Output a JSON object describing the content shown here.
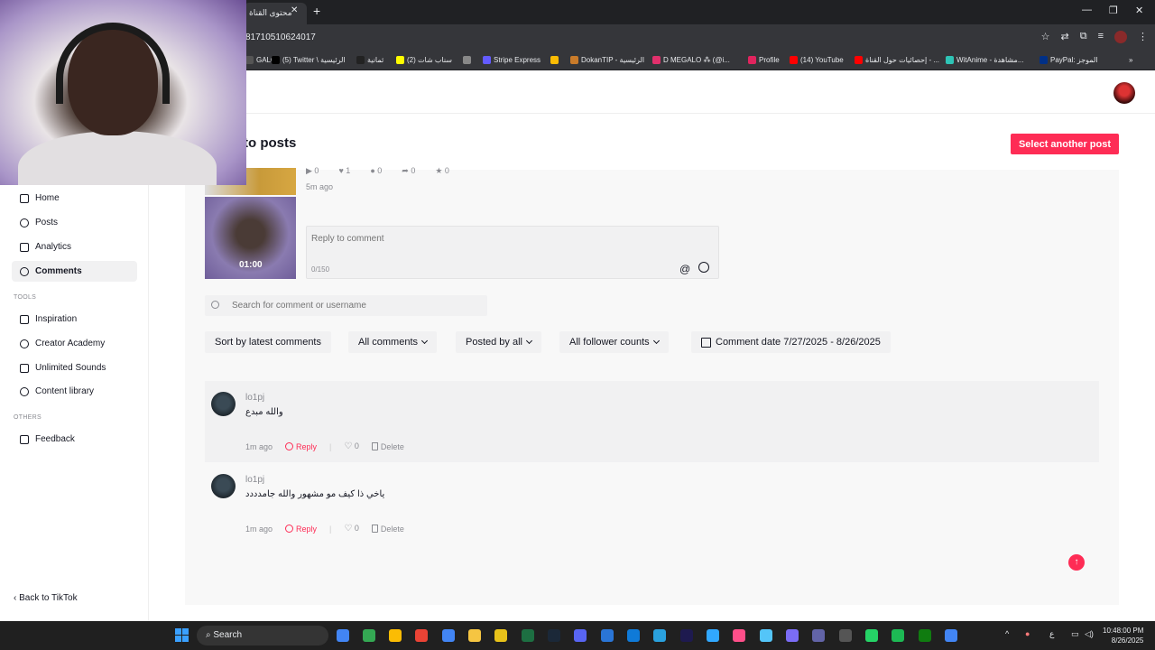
{
  "browser": {
    "tab_title": "محتوى القناة",
    "tab_close": "✕",
    "new_tab": "+",
    "url": "81710510624017",
    "window_controls": {
      "minimize": "—",
      "restore": "❐",
      "close": "✕"
    },
    "bookmarks_overflow": "»",
    "bookmarks": [
      {
        "label": "GALO",
        "color": "#555555"
      },
      {
        "label": "(5) Twitter \\ الرئيسية",
        "color": "#000000"
      },
      {
        "label": "ثمانية",
        "color": "#222222"
      },
      {
        "label": "(2) سناب شات",
        "color": "#fffc00"
      },
      {
        "label": "",
        "color": "#888888"
      },
      {
        "label": "Stripe Express",
        "color": "#635bff"
      },
      {
        "label": "",
        "color": "#fbbc04"
      },
      {
        "label": "DokanTIP - الرئيسية",
        "color": "#c97b2a"
      },
      {
        "label": "D MEGALO ⁂ (@i...",
        "color": "#e1306c"
      },
      {
        "label": "Profile",
        "color": "#e0245e"
      },
      {
        "label": "(14) YouTube",
        "color": "#ff0000"
      },
      {
        "label": "إحصائيات حول القناة - ...",
        "color": "#ff0000"
      },
      {
        "label": "WitAnime - مشاهدة...",
        "color": "#2ec4b6"
      },
      {
        "label": "PayPal: الموجز",
        "color": "#003087"
      }
    ]
  },
  "sidebar": {
    "items": [
      {
        "label": "Home",
        "icon": "home-icon",
        "active": false
      },
      {
        "label": "Posts",
        "icon": "posts-icon",
        "active": false
      },
      {
        "label": "Analytics",
        "icon": "analytics-icon",
        "active": false
      },
      {
        "label": "Comments",
        "icon": "comments-icon",
        "active": true
      }
    ],
    "tools_label": "TOOLS",
    "tools": [
      {
        "label": "Inspiration",
        "icon": "lightbulb-icon"
      },
      {
        "label": "Creator Academy",
        "icon": "academy-icon"
      },
      {
        "label": "Unlimited Sounds",
        "icon": "music-note-icon"
      },
      {
        "label": "Content library",
        "icon": "library-icon"
      }
    ],
    "others_label": "OTHERS",
    "others": [
      {
        "label": "Feedback",
        "icon": "feedback-icon"
      }
    ],
    "back_label": "‹ Back to TikTok"
  },
  "main": {
    "title": "to posts",
    "select_button": "Select another post",
    "post": {
      "thumb_duration": "01:00",
      "stats": [
        "0",
        "1",
        "0",
        "0",
        "0"
      ],
      "time_ago": "5m ago",
      "reply_placeholder": "Reply to comment",
      "char_count": "0/150",
      "at_symbol": "@"
    },
    "search_placeholder": "Search for comment or username",
    "filters": {
      "sort": "Sort by latest comments",
      "comments": "All comments",
      "posted_by": "Posted by all",
      "followers": "All follower counts",
      "date": "Comment date 7/27/2025 - 8/26/2025"
    },
    "comments": [
      {
        "username": "lo1pj",
        "text": "والله مبدع",
        "time": "1m ago",
        "reply": "Reply",
        "likes": "0",
        "delete": "Delete"
      },
      {
        "username": "lo1pj",
        "text": "ياخي ذا كيف مو مشهور والله جامدددد",
        "time": "1m ago",
        "reply": "Reply",
        "likes": "0",
        "delete": "Delete"
      }
    ],
    "accent_color": "#fe2c55"
  },
  "taskbar": {
    "search_label": "Search",
    "tray_lang": "ع",
    "time": "10:48:00 PM",
    "date": "8/26/2025"
  }
}
